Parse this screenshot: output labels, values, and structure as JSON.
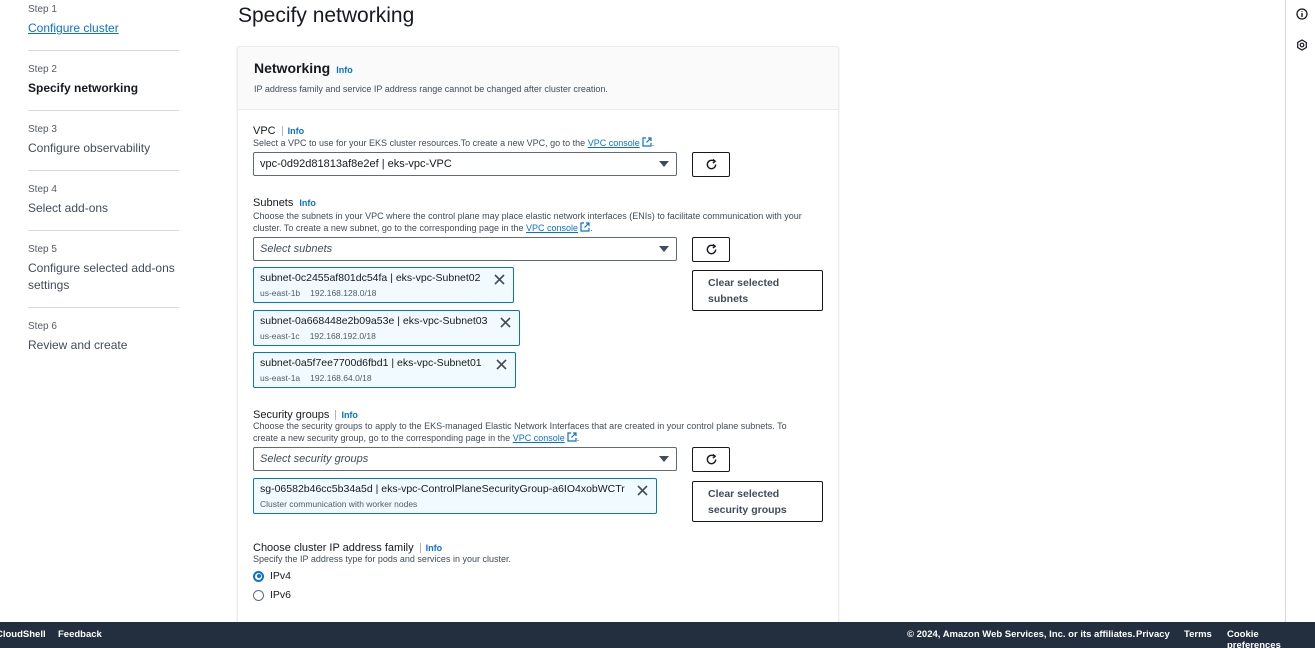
{
  "steps": [
    {
      "num": "Step 1",
      "title": "Configure cluster"
    },
    {
      "num": "Step 2",
      "title": "Specify networking"
    },
    {
      "num": "Step 3",
      "title": "Configure observability"
    },
    {
      "num": "Step 4",
      "title": "Select add-ons"
    },
    {
      "num": "Step 5",
      "title": "Configure selected add-ons settings"
    },
    {
      "num": "Step 6",
      "title": "Review and create"
    }
  ],
  "page_title": "Specify networking",
  "networking": {
    "header": "Networking",
    "info": "Info",
    "description": "IP address family and service IP address range cannot be changed after cluster creation."
  },
  "vpc": {
    "label": "VPC",
    "info": "Info",
    "description": "Select a VPC to use for your EKS cluster resources.To create a new VPC, go to the",
    "link": "VPC console",
    "link_suffix": ".",
    "selected": "vpc-0d92d81813af8e2ef | eks-vpc-VPC"
  },
  "subnets": {
    "label": "Subnets",
    "info": "Info",
    "description": "Choose the subnets in your VPC where the control plane may place elastic network interfaces (ENIs) to facilitate communication with your cluster. To create a new subnet, go to the corresponding page in the",
    "link": "VPC console",
    "link_suffix": ".",
    "placeholder": "Select subnets",
    "clear_label": "Clear selected subnets",
    "tokens": [
      {
        "name": "subnet-0c2455af801dc54fa | eks-vpc-Subnet02",
        "az": "us-east-1b",
        "cidr": "192.168.128.0/18"
      },
      {
        "name": "subnet-0a668448e2b09a53e | eks-vpc-Subnet03",
        "az": "us-east-1c",
        "cidr": "192.168.192.0/18"
      },
      {
        "name": "subnet-0a5f7ee7700d6fbd1 | eks-vpc-Subnet01",
        "az": "us-east-1a",
        "cidr": "192.168.64.0/18"
      }
    ]
  },
  "security_groups": {
    "label": "Security groups",
    "info": "Info",
    "description": "Choose the security groups to apply to the EKS-managed Elastic Network Interfaces that are created in your control plane subnets. To create a new security group, go to the corresponding page in the",
    "link": "VPC console",
    "link_suffix": ".",
    "placeholder": "Select security groups",
    "clear_label": "Clear selected security groups",
    "token": {
      "name": "sg-06582b46cc5b34a5d | eks-vpc-ControlPlaneSecurityGroup-a6IO4xobWCTr",
      "desc": "Cluster communication with worker nodes"
    }
  },
  "ip_family": {
    "label": "Choose cluster IP address family",
    "info": "Info",
    "description": "Specify the IP address type for pods and services in your cluster.",
    "options": [
      "IPv4",
      "IPv6"
    ],
    "selected": "IPv4"
  },
  "footer": {
    "cloudshell": "CloudShell",
    "feedback": "Feedback",
    "copyright": "© 2024, Amazon Web Services, Inc. or its affiliates.",
    "privacy": "Privacy",
    "terms": "Terms",
    "cookies": "Cookie preferences"
  },
  "colors": {
    "accent": "#0972d3",
    "footer_bg": "#232f3e"
  },
  "icons": [
    "external-link-icon",
    "refresh-icon",
    "close-icon",
    "info-circle-icon",
    "settings-icon"
  ]
}
